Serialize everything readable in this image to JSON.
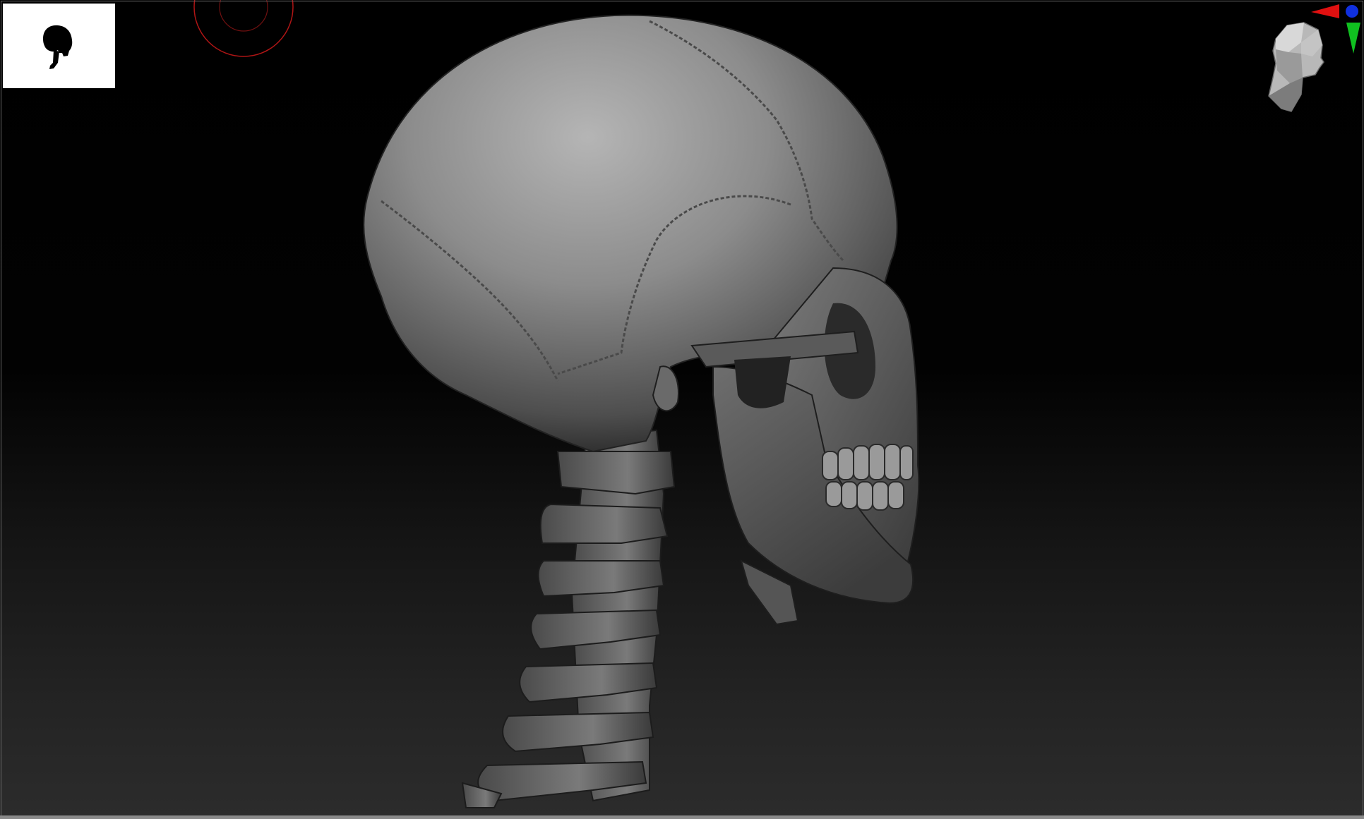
{
  "viewport": {
    "name": "3d-viewport",
    "background_top": "#000000",
    "background_bottom": "#2c2c2c"
  },
  "thumbnail": {
    "icon": "skull-silhouette-icon",
    "background": "#ffffff",
    "silhouette_color": "#000000"
  },
  "brush_cursor": {
    "icon": "brush-cursor-ring-icon",
    "color": "#b01515"
  },
  "model": {
    "icon": "skull-and-cervical-spine-icon",
    "material_color": "#8a8a8a"
  },
  "navigation": {
    "head_icon": "orientation-head-icon",
    "axis_icon": "axis-gizmo-icon",
    "x_axis_color": "#e01010",
    "y_axis_color": "#10c020",
    "z_axis_color": "#1030e0"
  }
}
